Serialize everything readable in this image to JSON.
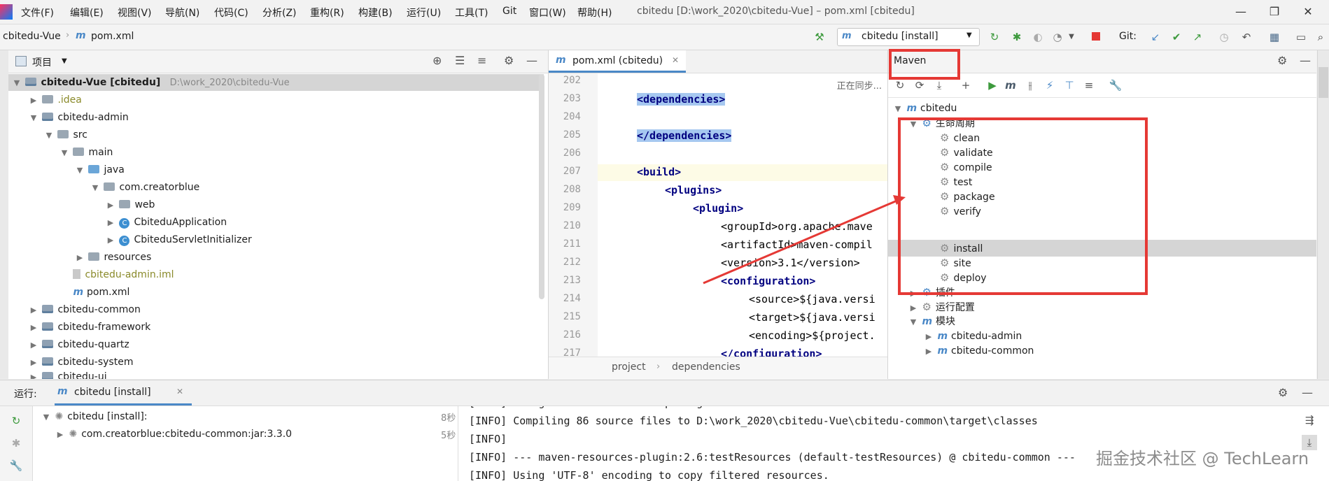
{
  "menu": {
    "items": [
      "文件(F)",
      "编辑(E)",
      "视图(V)",
      "导航(N)",
      "代码(C)",
      "分析(Z)",
      "重构(R)",
      "构建(B)",
      "运行(U)",
      "工具(T)",
      "Git",
      "窗口(W)",
      "帮助(H)"
    ],
    "window_title": "cbitedu [D:\\work_2020\\cbitedu-Vue] – pom.xml [cbitedu]"
  },
  "nav": {
    "breadcrumb_project": "cbitedu-Vue",
    "breadcrumb_file": "pom.xml",
    "run_config": "cbitedu [install]",
    "git_label": "Git:"
  },
  "project": {
    "title": "项目",
    "tree": [
      {
        "label": "cbitedu-Vue [cbitedu]",
        "path": "D:\\work_2020\\cbitedu-Vue"
      },
      {
        "label": ".idea"
      },
      {
        "label": "cbitedu-admin"
      },
      {
        "label": "src"
      },
      {
        "label": "main"
      },
      {
        "label": "java"
      },
      {
        "label": "com.creatorblue"
      },
      {
        "label": "web"
      },
      {
        "label": "CbiteduApplication"
      },
      {
        "label": "CbiteduServletInitializer"
      },
      {
        "label": "resources"
      },
      {
        "label": "cbitedu-admin.iml"
      },
      {
        "label": "pom.xml"
      },
      {
        "label": "cbitedu-common"
      },
      {
        "label": "cbitedu-framework"
      },
      {
        "label": "cbitedu-quartz"
      },
      {
        "label": "cbitedu-system"
      },
      {
        "label": "cbitedu-ui"
      }
    ]
  },
  "editor": {
    "tab": "pom.xml (cbitedu)",
    "status": "正在同步...",
    "lines": [
      {
        "n": "202",
        "text": ""
      },
      {
        "n": "203",
        "text": "<dependencies>"
      },
      {
        "n": "204",
        "text": ""
      },
      {
        "n": "205",
        "text": "</dependencies>"
      },
      {
        "n": "206",
        "text": ""
      },
      {
        "n": "207",
        "text": "<build>"
      },
      {
        "n": "208",
        "text": "<plugins>"
      },
      {
        "n": "209",
        "text": "<plugin>"
      },
      {
        "n": "210",
        "text": "<groupId>org.apache.mave"
      },
      {
        "n": "211",
        "text": "<artifactId>maven-compil"
      },
      {
        "n": "212",
        "text": "<version>3.1</version>"
      },
      {
        "n": "213",
        "text": "<configuration>"
      },
      {
        "n": "214",
        "text": "<source>${java.versi"
      },
      {
        "n": "215",
        "text": "<target>${java.versi"
      },
      {
        "n": "216",
        "text": "<encoding>${project."
      },
      {
        "n": "217",
        "text": "</configuration>"
      }
    ],
    "crumbs": [
      "project",
      "dependencies"
    ]
  },
  "maven": {
    "title": "Maven",
    "root": "cbitedu",
    "lifecycle_label": "生命周期",
    "lifecycle": [
      "clean",
      "validate",
      "compile",
      "test",
      "package",
      "verify",
      "install",
      "site",
      "deploy"
    ],
    "selected": "install",
    "plugins_label": "插件",
    "run_configs_label": "运行配置",
    "modules_label": "模块",
    "modules": [
      "cbitedu-admin",
      "cbitedu-common"
    ]
  },
  "run": {
    "label": "运行:",
    "tab": "cbitedu [install]",
    "tree": [
      {
        "label": "cbitedu [install]:",
        "time": "8秒"
      },
      {
        "label": "com.creatorblue:cbitedu-common:jar:3.3.0",
        "time": "5秒"
      }
    ],
    "console": [
      "[INFO] Changes detected - recompiling the module!",
      "[INFO] Compiling 86 source files to D:\\work_2020\\cbitedu-Vue\\cbitedu-common\\target\\classes",
      "[INFO]",
      "[INFO] --- maven-resources-plugin:2.6:testResources (default-testResources) @ cbitedu-common ---",
      "[INFO] Using 'UTF-8' encoding to copy filtered resources."
    ]
  },
  "watermark": "掘金技术社区 @ TechLearn",
  "colors": {
    "accent": "#4a88c7",
    "highlight": "#e53935",
    "selection": "#a6c8f0"
  }
}
